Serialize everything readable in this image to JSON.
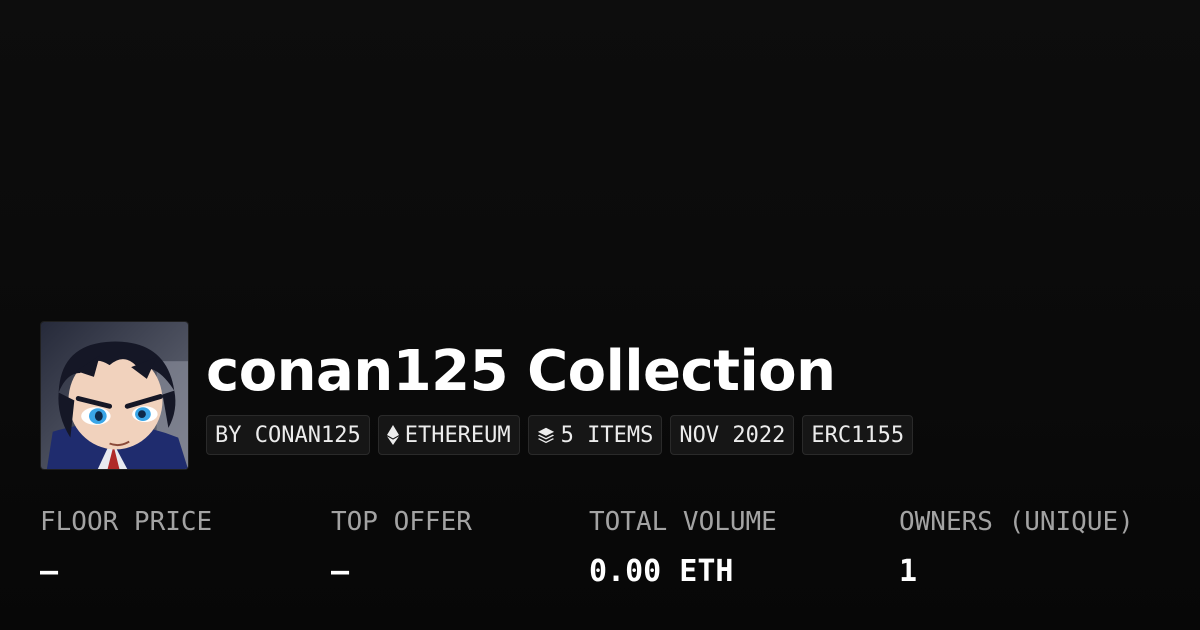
{
  "collection": {
    "title": "conan125 Collection",
    "avatar_icon": "anime-character-avatar"
  },
  "badges": {
    "creator": "BY CONAN125",
    "chain": {
      "label": "ETHEREUM",
      "icon": "ethereum-icon"
    },
    "items": {
      "label": "5 ITEMS",
      "icon": "layers-icon"
    },
    "date": "NOV 2022",
    "standard": "ERC1155"
  },
  "stats": {
    "floor_price": {
      "label": "FLOOR PRICE",
      "value": "–"
    },
    "top_offer": {
      "label": "TOP OFFER",
      "value": "–"
    },
    "total_volume": {
      "label": "TOTAL VOLUME",
      "value": "0.00 ETH"
    },
    "owners": {
      "label": "OWNERS (UNIQUE)",
      "value": "1"
    }
  },
  "colors": {
    "background": "#0a0a0a",
    "text": "#ffffff",
    "label": "#a3a3a3",
    "badge_bg": "#161616",
    "badge_border": "#2a2a2a"
  }
}
